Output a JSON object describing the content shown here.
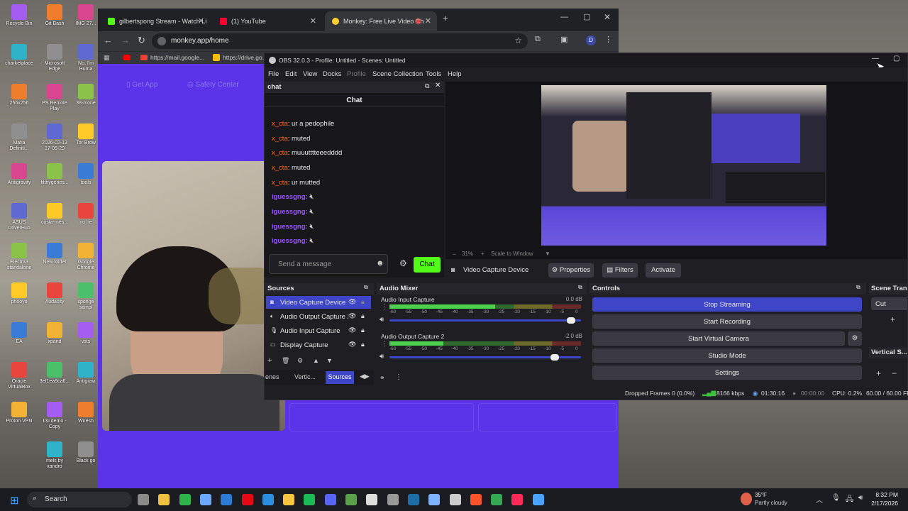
{
  "desktop": {
    "icons_col1": [
      "Recycle Bin",
      "charketplace",
      "256x256",
      "Mafia Definiti...",
      "Antigravity",
      "ASUS DriverHub",
      "Electra3 standalone",
      "phooyo",
      "EA",
      "Oracle VirtualBox",
      "Proton VPN"
    ],
    "icons_col2": [
      "Git Bash",
      "Microsoft Edge",
      "PS Remote Play",
      "2026-02-13 17-05-29",
      "filthygenes...",
      "costa-mes...",
      "New folder",
      "Audacity",
      "xpand",
      "3ef1ea9ca6...",
      "Irsi demo - Copy",
      "mels by xandro"
    ],
    "icons_col3": [
      "IMG 27...",
      "No, I'm Huma",
      "38-mone",
      "Tor Brow",
      "tools",
      "no he",
      "Google Chrome",
      "sponge sampl",
      "vsts",
      "Antigravi",
      "Wiresh",
      "Black go"
    ]
  },
  "chrome": {
    "tabs": [
      {
        "label": "gilbertspong Stream - Watch Li",
        "color": "#53fc18"
      },
      {
        "label": "(1) YouTube",
        "color": "#ff0033"
      },
      {
        "label": "Monkey: Free Live Video Ch",
        "color": "#ffcc33"
      }
    ],
    "url": "monkey.app/home",
    "bookmarks": [
      "https://mail.google...",
      "https://drive.go..."
    ],
    "profile_initial": "D",
    "monkey_nav": [
      "Get App",
      "Safety Center"
    ]
  },
  "obs": {
    "title": "OBS 32.0.3 - Profile: Untitled - Scenes: Untitled",
    "menu": [
      "File",
      "Edit",
      "View",
      "Docks",
      "Profile",
      "Scene Collection",
      "Tools",
      "Help"
    ],
    "chat": {
      "dock_title": "chat",
      "header": "Chat",
      "messages": [
        {
          "user": "x_cta",
          "text": ": ur a pedophile"
        },
        {
          "user": "x_cta",
          "text": ": muted"
        },
        {
          "user": "x_cta",
          "text": ": muuutttteeedddd"
        },
        {
          "user": "x_cta",
          "text": ": muted"
        },
        {
          "user": "x_cta",
          "text": ": ur mutted"
        }
      ],
      "emote_user": "iguessgng:",
      "placeholder": "Send a message",
      "send_label": "Chat"
    },
    "preview": {
      "zoom": "31%",
      "scale_mode": "Scale to Window"
    },
    "source_toolbar": {
      "name": "Video Capture Device",
      "properties": "Properties",
      "filters": "Filters",
      "activate": "Activate"
    },
    "sources": {
      "title": "Sources",
      "items": [
        "Video Capture Device",
        "Audio Output Capture 2",
        "Audio Input Capture",
        "Display Capture"
      ]
    },
    "dock_tabs": [
      "enes",
      "Vertic...",
      "Sources"
    ],
    "mixer": {
      "title": "Audio Mixer",
      "channels": [
        {
          "name": "Audio Input Capture",
          "db": "0.0 dB",
          "level": 0.55,
          "volume": 0.97
        },
        {
          "name": "Audio Output Capture 2",
          "db": "-2.0 dB",
          "level": 0.28,
          "volume": 0.88
        }
      ],
      "scale": [
        "-60",
        "-55",
        "-50",
        "-45",
        "-40",
        "-35",
        "-30",
        "-25",
        "-20",
        "-15",
        "-10",
        "-5",
        "0"
      ]
    },
    "controls": {
      "title": "Controls",
      "buttons": [
        "Stop Streaming",
        "Start Recording",
        "Start Virtual Camera",
        "Studio Mode",
        "Settings"
      ]
    },
    "scene_transitions": {
      "title": "Scene Trans",
      "value": "Cut"
    },
    "vertical": {
      "title": "Vertical S..."
    },
    "status": {
      "dropped": "Dropped Frames 0 (0.0%)",
      "kbps": "8166 kbps",
      "stream_time": "01:30:16",
      "rec_time": "00:00:00",
      "cpu": "CPU: 0.2%",
      "fps": "60.00 / 60.00 FP"
    }
  },
  "taskbar": {
    "search": "Search",
    "weather_temp": "35°F",
    "weather_desc": "Partly cloudy",
    "time": "8:32 PM",
    "date": "2/17/2026"
  }
}
